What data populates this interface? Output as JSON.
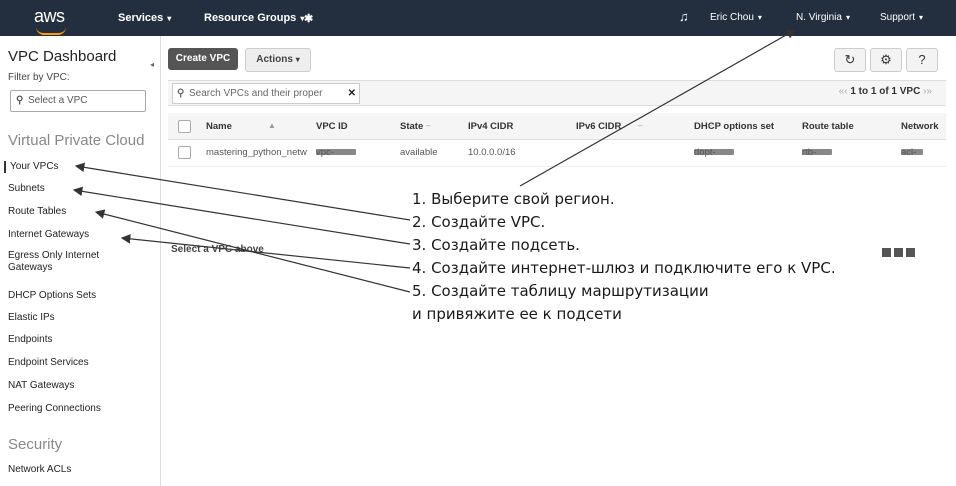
{
  "topbar": {
    "logo": "aws",
    "services": "Services",
    "resource_groups": "Resource Groups",
    "user": "Eric Chou",
    "region": "N. Virginia",
    "support": "Support"
  },
  "sidebar": {
    "title": "VPC Dashboard",
    "filter_label": "Filter by VPC:",
    "filter_placeholder": "Select a VPC",
    "section_vpc": "Virtual Private Cloud",
    "items": [
      "Your VPCs",
      "Subnets",
      "Route Tables",
      "Internet Gateways",
      "Egress Only Internet Gateways",
      "DHCP Options Sets",
      "Elastic IPs",
      "Endpoints",
      "Endpoint Services",
      "NAT Gateways",
      "Peering Connections"
    ],
    "section_security": "Security",
    "security_items": [
      "Network ACLs"
    ]
  },
  "toolbar": {
    "create_vpc": "Create VPC",
    "actions": "Actions"
  },
  "search": {
    "placeholder": "Search VPCs and their proper",
    "pager": "1 to 1 of 1 VPC"
  },
  "table": {
    "columns": [
      "Name",
      "VPC ID",
      "State",
      "IPv4 CIDR",
      "IPv6 CIDR",
      "DHCP options set",
      "Route table",
      "Network"
    ],
    "row": {
      "name": "mastering_python_netw",
      "vpc_id": "vpc-",
      "state": "available",
      "ipv4": "10.0.0.0/16",
      "ipv6": "",
      "dhcp": "dopt-",
      "route_table": "rtb-",
      "network": "acl-"
    }
  },
  "detail": {
    "empty_text": "Select a VPC above"
  },
  "annotations": [
    "1. Выберите свой регион.",
    "2. Создайте VPC.",
    "3. Создайте подсеть.",
    "4. Создайте интернет-шлюз и подключите его к VPC.",
    "5. Создайте таблицу маршрутизации",
    "и привяжите ее к подсети"
  ]
}
